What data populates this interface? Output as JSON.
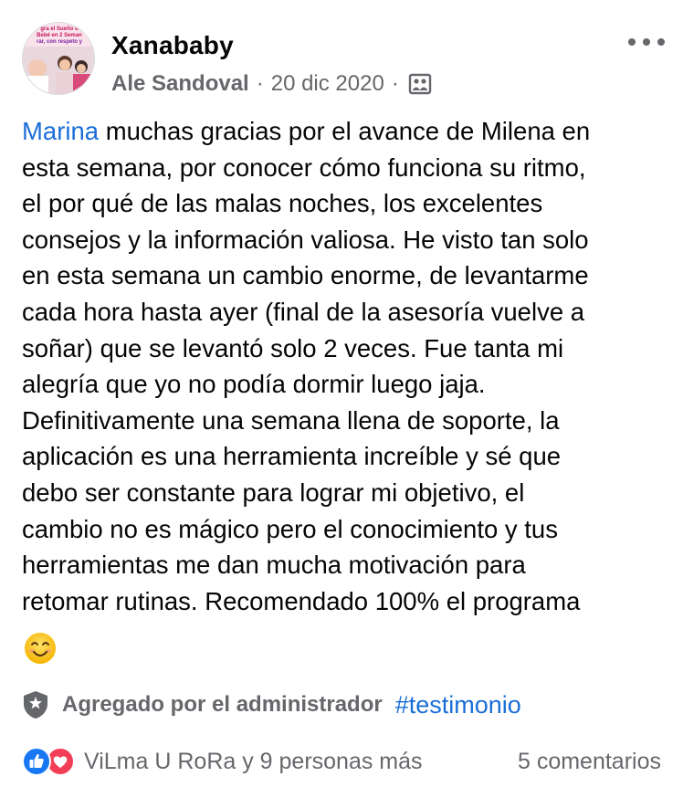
{
  "post": {
    "group_name": "Xanababy",
    "author": "Ale Sandoval",
    "separator": "·",
    "date": "20 dic 2020",
    "avatar_text": {
      "line1": "gra el Sueño d",
      "line2": "Bebé en 2 Seman",
      "line3": "rar, con respeto y"
    },
    "mention": "Marina",
    "body_lines": [
      " muchas gracias por el avance de Milena en",
      "esta semana, por conocer cómo funciona su ritmo,",
      "el por qué de las malas noches, los excelentes",
      "consejos y la información valiosa. He visto tan solo",
      "en esta semana un cambio enorme, de levantarme",
      "cada hora hasta ayer (final de la asesoría vuelve a",
      "soñar) que se levantó solo 2 veces. Fue tanta mi",
      "alegría que yo no podía dormir luego jaja.",
      "Definitivamente una semana llena de soporte, la",
      "aplicación es una herramienta increíble y sé que",
      "debo ser constante para lograr mi objetivo, el",
      "cambio no es mágico pero el conocimiento y tus",
      "herramientas me dan mucha motivación para",
      "retomar rutinas. Recomendado 100% el programa"
    ],
    "emoji_name": "smiling-face-emoji",
    "admin_label": "Agregado por el administrador",
    "hashtag": "#testimonio",
    "reactions_text": "ViLma U RoRa y 9 personas más",
    "comments_text": "5 comentarios",
    "colors": {
      "link": "#1a6ed8",
      "secondary_text": "#65676b",
      "like": "#1877f2",
      "love": "#f33e58"
    }
  }
}
